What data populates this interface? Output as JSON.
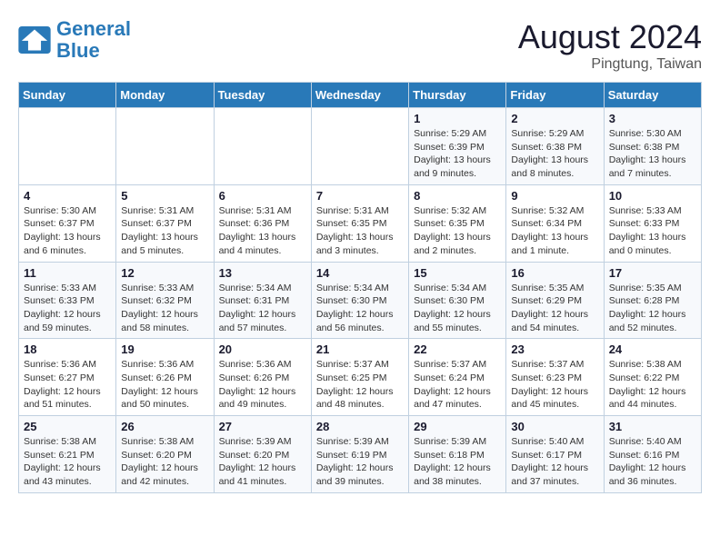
{
  "logo": {
    "text_general": "General",
    "text_blue": "Blue"
  },
  "header": {
    "month": "August 2024",
    "location": "Pingtung, Taiwan"
  },
  "days_of_week": [
    "Sunday",
    "Monday",
    "Tuesday",
    "Wednesday",
    "Thursday",
    "Friday",
    "Saturday"
  ],
  "weeks": [
    [
      {
        "day": "",
        "detail": ""
      },
      {
        "day": "",
        "detail": ""
      },
      {
        "day": "",
        "detail": ""
      },
      {
        "day": "",
        "detail": ""
      },
      {
        "day": "1",
        "detail": "Sunrise: 5:29 AM\nSunset: 6:39 PM\nDaylight: 13 hours\nand 9 minutes."
      },
      {
        "day": "2",
        "detail": "Sunrise: 5:29 AM\nSunset: 6:38 PM\nDaylight: 13 hours\nand 8 minutes."
      },
      {
        "day": "3",
        "detail": "Sunrise: 5:30 AM\nSunset: 6:38 PM\nDaylight: 13 hours\nand 7 minutes."
      }
    ],
    [
      {
        "day": "4",
        "detail": "Sunrise: 5:30 AM\nSunset: 6:37 PM\nDaylight: 13 hours\nand 6 minutes."
      },
      {
        "day": "5",
        "detail": "Sunrise: 5:31 AM\nSunset: 6:37 PM\nDaylight: 13 hours\nand 5 minutes."
      },
      {
        "day": "6",
        "detail": "Sunrise: 5:31 AM\nSunset: 6:36 PM\nDaylight: 13 hours\nand 4 minutes."
      },
      {
        "day": "7",
        "detail": "Sunrise: 5:31 AM\nSunset: 6:35 PM\nDaylight: 13 hours\nand 3 minutes."
      },
      {
        "day": "8",
        "detail": "Sunrise: 5:32 AM\nSunset: 6:35 PM\nDaylight: 13 hours\nand 2 minutes."
      },
      {
        "day": "9",
        "detail": "Sunrise: 5:32 AM\nSunset: 6:34 PM\nDaylight: 13 hours\nand 1 minute."
      },
      {
        "day": "10",
        "detail": "Sunrise: 5:33 AM\nSunset: 6:33 PM\nDaylight: 13 hours\nand 0 minutes."
      }
    ],
    [
      {
        "day": "11",
        "detail": "Sunrise: 5:33 AM\nSunset: 6:33 PM\nDaylight: 12 hours\nand 59 minutes."
      },
      {
        "day": "12",
        "detail": "Sunrise: 5:33 AM\nSunset: 6:32 PM\nDaylight: 12 hours\nand 58 minutes."
      },
      {
        "day": "13",
        "detail": "Sunrise: 5:34 AM\nSunset: 6:31 PM\nDaylight: 12 hours\nand 57 minutes."
      },
      {
        "day": "14",
        "detail": "Sunrise: 5:34 AM\nSunset: 6:30 PM\nDaylight: 12 hours\nand 56 minutes."
      },
      {
        "day": "15",
        "detail": "Sunrise: 5:34 AM\nSunset: 6:30 PM\nDaylight: 12 hours\nand 55 minutes."
      },
      {
        "day": "16",
        "detail": "Sunrise: 5:35 AM\nSunset: 6:29 PM\nDaylight: 12 hours\nand 54 minutes."
      },
      {
        "day": "17",
        "detail": "Sunrise: 5:35 AM\nSunset: 6:28 PM\nDaylight: 12 hours\nand 52 minutes."
      }
    ],
    [
      {
        "day": "18",
        "detail": "Sunrise: 5:36 AM\nSunset: 6:27 PM\nDaylight: 12 hours\nand 51 minutes."
      },
      {
        "day": "19",
        "detail": "Sunrise: 5:36 AM\nSunset: 6:26 PM\nDaylight: 12 hours\nand 50 minutes."
      },
      {
        "day": "20",
        "detail": "Sunrise: 5:36 AM\nSunset: 6:26 PM\nDaylight: 12 hours\nand 49 minutes."
      },
      {
        "day": "21",
        "detail": "Sunrise: 5:37 AM\nSunset: 6:25 PM\nDaylight: 12 hours\nand 48 minutes."
      },
      {
        "day": "22",
        "detail": "Sunrise: 5:37 AM\nSunset: 6:24 PM\nDaylight: 12 hours\nand 47 minutes."
      },
      {
        "day": "23",
        "detail": "Sunrise: 5:37 AM\nSunset: 6:23 PM\nDaylight: 12 hours\nand 45 minutes."
      },
      {
        "day": "24",
        "detail": "Sunrise: 5:38 AM\nSunset: 6:22 PM\nDaylight: 12 hours\nand 44 minutes."
      }
    ],
    [
      {
        "day": "25",
        "detail": "Sunrise: 5:38 AM\nSunset: 6:21 PM\nDaylight: 12 hours\nand 43 minutes."
      },
      {
        "day": "26",
        "detail": "Sunrise: 5:38 AM\nSunset: 6:20 PM\nDaylight: 12 hours\nand 42 minutes."
      },
      {
        "day": "27",
        "detail": "Sunrise: 5:39 AM\nSunset: 6:20 PM\nDaylight: 12 hours\nand 41 minutes."
      },
      {
        "day": "28",
        "detail": "Sunrise: 5:39 AM\nSunset: 6:19 PM\nDaylight: 12 hours\nand 39 minutes."
      },
      {
        "day": "29",
        "detail": "Sunrise: 5:39 AM\nSunset: 6:18 PM\nDaylight: 12 hours\nand 38 minutes."
      },
      {
        "day": "30",
        "detail": "Sunrise: 5:40 AM\nSunset: 6:17 PM\nDaylight: 12 hours\nand 37 minutes."
      },
      {
        "day": "31",
        "detail": "Sunrise: 5:40 AM\nSunset: 6:16 PM\nDaylight: 12 hours\nand 36 minutes."
      }
    ]
  ]
}
